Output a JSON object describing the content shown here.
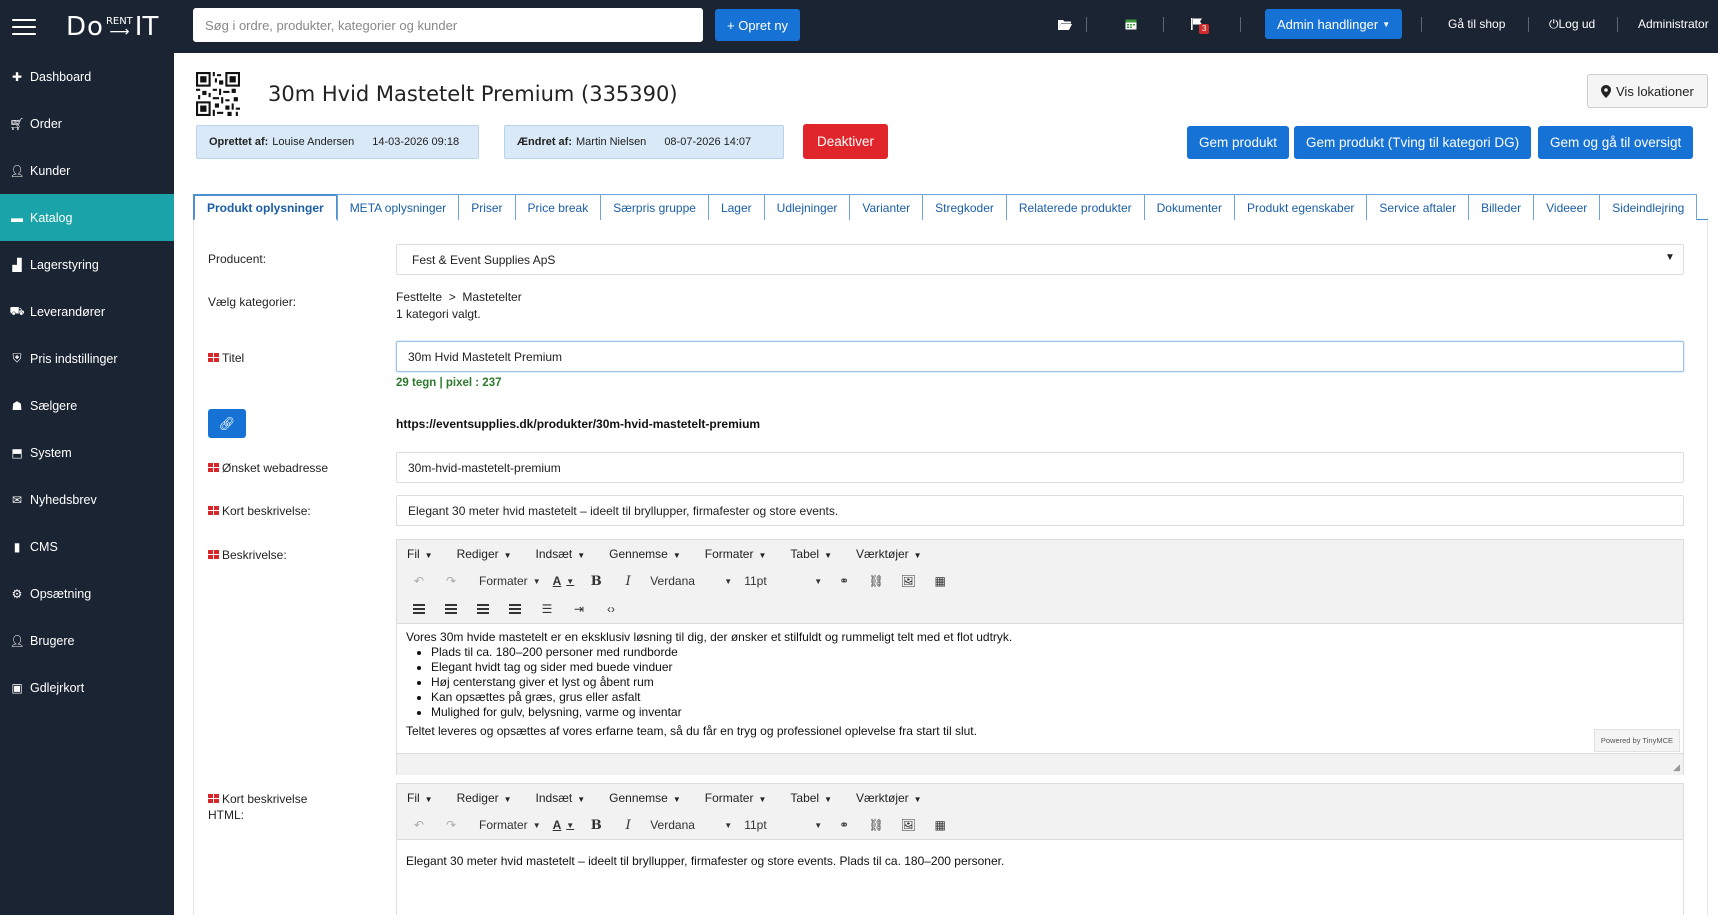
{
  "app": {
    "logo_do": "Do",
    "logo_rent": "RENT",
    "logo_it": "IT"
  },
  "topbar": {
    "search_placeholder": "Søg i ordre, produkter, kategorier og kunder",
    "create_label": "+ Opret ny",
    "flag_badge": "3",
    "admin_label": "Admin handlinger",
    "shop_label": "Gå til shop",
    "logout_label": "Log ud",
    "user_label": "Administrator"
  },
  "sidebar": {
    "items": [
      {
        "label": "Dashboard",
        "icon": "dashboard-icon"
      },
      {
        "label": "Order",
        "icon": "cart-icon"
      },
      {
        "label": "Kunder",
        "icon": "user-icon"
      },
      {
        "label": "Katalog",
        "icon": "folder-icon",
        "active": true
      },
      {
        "label": "Lagerstyring",
        "icon": "chart-icon"
      },
      {
        "label": "Leverandører",
        "icon": "truck-icon"
      },
      {
        "label": "Pris indstillinger",
        "icon": "price-icon"
      },
      {
        "label": "Sælgere",
        "icon": "sellers-icon"
      },
      {
        "label": "System",
        "icon": "system-icon"
      },
      {
        "label": "Nyhedsbrev",
        "icon": "envelope-icon"
      },
      {
        "label": "CMS",
        "icon": "file-icon"
      },
      {
        "label": "Opsætning",
        "icon": "gear-icon"
      },
      {
        "label": "Brugere",
        "icon": "user-icon"
      },
      {
        "label": "Gdlejrkort",
        "icon": "gift-icon"
      }
    ]
  },
  "product": {
    "title": "30m Hvid Mastetelt Premium (335390)",
    "created_label": "Oprettet af:",
    "created_by": "Louise Andersen",
    "created_date": "14-03-2026 09:18",
    "changed_label": "Ændret af:",
    "changed_by": "Martin Nielsen",
    "changed_date": "08-07-2026 14:07",
    "deactivate_label": "Deaktiver",
    "save_label": "Gem produkt",
    "save_force_label": "Gem produkt (Tving til kategori DG)",
    "save_overview_label": "Gem og gå til oversigt",
    "locations_label": "Vis lokationer"
  },
  "tabs": [
    "Produkt oplysninger",
    "META oplysninger",
    "Priser",
    "Price break",
    "Særpris gruppe",
    "Lager",
    "Udlejninger",
    "Varianter",
    "Stregkoder",
    "Relaterede produkter",
    "Dokumenter",
    "Produkt egenskaber",
    "Service aftaler",
    "Billeder",
    "Videeer",
    "Sideindlejring"
  ],
  "form": {
    "producer_label": "Producent:",
    "producer_value": "Fest & Event Supplies ApS",
    "category_label": "Vælg kategorier:",
    "category_path": "Festtelte  >  Mastetelter",
    "category_count": "1 kategori valgt.",
    "title_label": "Titel",
    "title_value": "30m Hvid Mastetelt Premium",
    "title_counter": "29 tegn | pixel : 237",
    "url_value": "https://eventsupplies.dk/produkter/30m-hvid-mastetelt-premium",
    "webaddress_label": "Ønsket webadresse",
    "webaddress_value": "30m-hvid-mastetelt-premium",
    "short_desc_label": "Kort beskrivelse:",
    "short_desc_value": "Elegant 30 meter hvid mastetelt – ideelt til bryllupper, firmafester og store events.",
    "desc_label": "Beskrivelse:",
    "short_html_label_1": "Kort beskrivelse",
    "short_html_label_2": "HTML:"
  },
  "editor": {
    "menu": [
      "Fil",
      "Rediger",
      "Indsæt",
      "Gennemse",
      "Formater",
      "Tabel",
      "Værktøjer"
    ],
    "format_label": "Formater",
    "font_label": "Verdana",
    "size_label": "11pt",
    "powered": "Powered by TinyMCE",
    "desc_intro": "Vores 30m hvide mastetelt er en eksklusiv løsning til dig, der ønsker et stilfuldt og rummeligt telt med et flot udtryk.",
    "desc_bullets": [
      "Plads til ca. 180–200 personer med rundborde",
      "Elegant hvidt tag og sider med buede vinduer",
      "Høj centerstang giver et lyst og åbent rum",
      "Kan opsættes på græs, grus eller asfalt",
      "Mulighed for gulv, belysning, varme og inventar"
    ],
    "desc_outro": "Teltet leveres og opsættes af vores erfarne team, så du får en tryg og professionel oplevelse fra start til slut.",
    "short_html_body": "Elegant 30 meter hvid mastetelt – ideelt til bryllupper, firmafester og store events. Plads til ca. 180–200 personer."
  }
}
